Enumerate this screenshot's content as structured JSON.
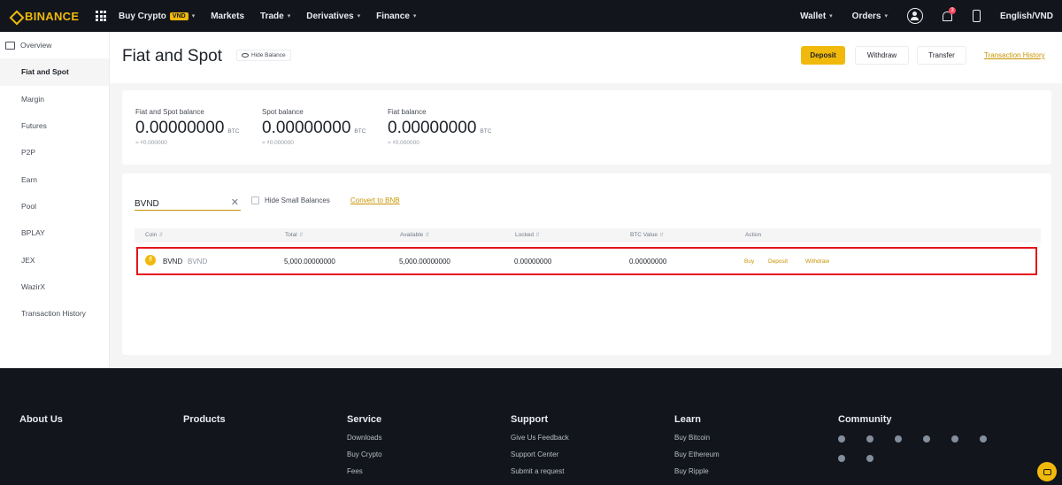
{
  "nav": {
    "brand": "BINANCE",
    "items": [
      {
        "label": "Buy Crypto",
        "badge": "VND",
        "caret": true
      },
      {
        "label": "Markets",
        "caret": false
      },
      {
        "label": "Trade",
        "caret": true
      },
      {
        "label": "Derivatives",
        "caret": true
      },
      {
        "label": "Finance",
        "caret": true
      }
    ],
    "right": {
      "wallet": "Wallet",
      "orders": "Orders",
      "notif_count": "3",
      "language": "English/VND"
    }
  },
  "sidebar": {
    "items": [
      "Overview",
      "Fiat and Spot",
      "Margin",
      "Futures",
      "P2P",
      "Earn",
      "Pool",
      "BPLAY",
      "JEX",
      "WazirX",
      "Transaction History"
    ],
    "active": "Fiat and Spot"
  },
  "header": {
    "title": "Fiat and Spot",
    "hide_balance": "Hide Balance",
    "buttons": {
      "deposit": "Deposit",
      "withdraw": "Withdraw",
      "transfer": "Transfer"
    },
    "history_link": "Transaction History"
  },
  "balances": [
    {
      "label": "Fiat and Spot balance",
      "value": "0.00000000",
      "unit": "BTC",
      "sub": "≈ ₫0.000000"
    },
    {
      "label": "Spot balance",
      "value": "0.00000000",
      "unit": "BTC",
      "sub": "≈ ₫0.000000"
    },
    {
      "label": "Fiat balance",
      "value": "0.00000000",
      "unit": "BTC",
      "sub": "≈ ₫0.000000"
    }
  ],
  "assets": {
    "search_value": "BVND",
    "hide_small": "Hide Small Balances",
    "convert_link": "Convert to BNB",
    "columns": [
      "Coin",
      "Total",
      "Available",
      "Locked",
      "BTC Value",
      "Action"
    ],
    "row": {
      "symbol": "BVND",
      "name": "BVND",
      "total": "5,000.00000000",
      "available": "5,000.00000000",
      "locked": "0.00000000",
      "btc_value": "0.00000000",
      "actions": [
        "Buy",
        "Deposit",
        "Withdraw"
      ]
    }
  },
  "footer": {
    "about": "About Us",
    "products": "Products",
    "service": {
      "title": "Service",
      "links": [
        "Downloads",
        "Buy Crypto",
        "Fees"
      ]
    },
    "support": {
      "title": "Support",
      "links": [
        "Give Us Feedback",
        "Support Center",
        "Submit a request"
      ]
    },
    "learn": {
      "title": "Learn",
      "links": [
        "Buy Bitcoin",
        "Buy Ethereum",
        "Buy Ripple"
      ]
    },
    "community": "Community",
    "social_icons": [
      "telegram-icon",
      "facebook-icon",
      "twitter-icon",
      "reddit-icon",
      "instagram-icon",
      "coinmarketcap-icon",
      "vk-icon",
      "youtube-icon"
    ]
  },
  "colors": {
    "brand": "#f0b90b",
    "dark": "#12161c",
    "highlight": "#e5131c",
    "link": "#c99400"
  }
}
